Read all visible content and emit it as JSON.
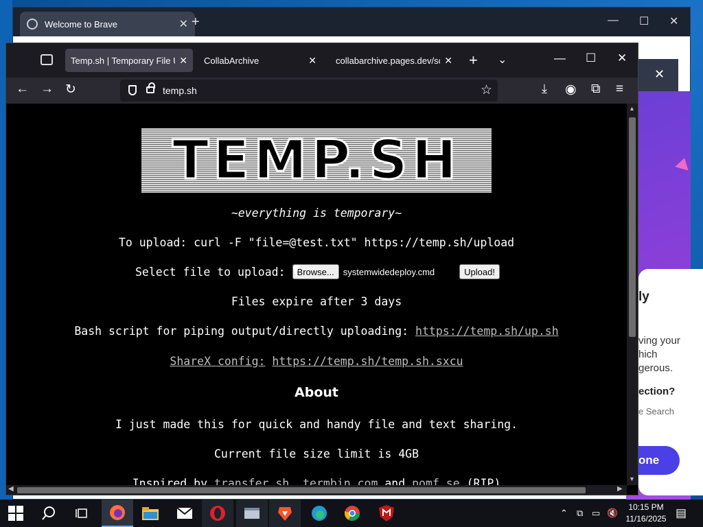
{
  "brave": {
    "tab_title": "Welcome to Brave",
    "card": {
      "heading_fragment": "ly",
      "body_lines": [
        "ving your",
        "hich",
        "gerous."
      ],
      "question_fragment": "ection?",
      "sub_fragment": "e Search",
      "button_fragment": "one"
    }
  },
  "firefox": {
    "tabs": [
      {
        "label": "Temp.sh | Temporary File Uplo",
        "active": true
      },
      {
        "label": "CollabArchive",
        "active": false
      },
      {
        "label": "collabarchive.pages.dev/scrip",
        "active": false
      }
    ],
    "url": "temp.sh"
  },
  "page": {
    "logo_text": "TEMP.SH",
    "tagline": "~everything is temporary~",
    "curl_line": "To upload: curl -F \"file=@test.txt\" https://temp.sh/upload",
    "select_label": "Select file to upload:",
    "browse_button": "Browse...",
    "selected_file": "systemwidedeploy.cmd",
    "upload_button": "Upload!",
    "expire_text": "Files expire after 3 days",
    "bash_prefix": "Bash script for piping output/directly uploading:",
    "bash_link": "https://temp.sh/up.sh",
    "sharex_label": "ShareX config:",
    "sharex_link": "https://temp.sh/temp.sh.sxcu",
    "about_heading": "About",
    "about_text": "I just made this for quick and handy file and text sharing.",
    "size_limit": "Current file size limit is 4GB",
    "inspired_prefix": "Inspired by",
    "inspired_links": [
      "transfer.sh",
      "termbin.com"
    ],
    "inspired_and": "and",
    "inspired_last": "pomf.se",
    "inspired_suffix": "(RIP)"
  },
  "taskbar": {
    "time": "10:15 PM",
    "date": "11/16/2025"
  }
}
